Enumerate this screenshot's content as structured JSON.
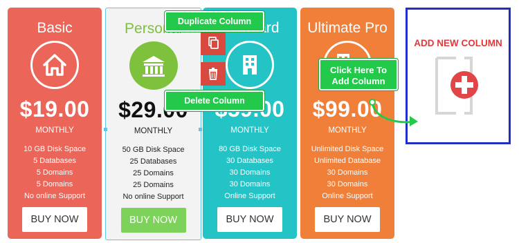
{
  "columns": [
    {
      "id": "basic",
      "title": "Basic",
      "icon": "home-icon",
      "price": "$19.00",
      "period": "MONTHLY",
      "features": [
        "10 GB Disk Space",
        "5 Databases",
        "5 Domains",
        "5 Domains",
        "No online Support"
      ],
      "button": "BUY NOW"
    },
    {
      "id": "personal",
      "title": "Personal",
      "icon": "bank-icon",
      "price": "$29.00",
      "period": "MONTHLY",
      "features": [
        "50 GB Disk Space",
        "25 Databases",
        "25 Domains",
        "25 Domains",
        "No online Support"
      ],
      "button": "BUY NOW"
    },
    {
      "id": "standard",
      "title": "Standard",
      "icon": "building-icon",
      "price": "$59.00",
      "period": "MONTHLY",
      "features": [
        "80 GB Disk Space",
        "30 Databases",
        "30 Domains",
        "30 Domains",
        "Online Support"
      ],
      "button": "BUY NOW"
    },
    {
      "id": "ultimate",
      "title": "Ultimate Pro",
      "icon": "city-icon",
      "price": "$99.00",
      "period": "MONTHLY",
      "features": [
        "Unlimited Disk Space",
        "Unlimited Database",
        "30 Domains",
        "30 Domains",
        "Online Support"
      ],
      "button": "BUY NOW"
    }
  ],
  "add_column": {
    "label": "ADD NEW COLUMN",
    "icon": "add-file-icon"
  },
  "tools": {
    "duplicate_icon": "copy-icon",
    "delete_icon": "trash-icon"
  },
  "callouts": {
    "duplicate": "Duplicate Column",
    "delete": "Delete Column",
    "add_line1": "Click Here To",
    "add_line2": "Add Column"
  },
  "colors": {
    "basic": "#ec6559",
    "personal_accent": "#7dc13c",
    "standard": "#24c3c6",
    "ultimate": "#f07f3a",
    "add_border": "#1f2ec9",
    "add_label": "#e0393b",
    "callout": "#22c94b"
  }
}
